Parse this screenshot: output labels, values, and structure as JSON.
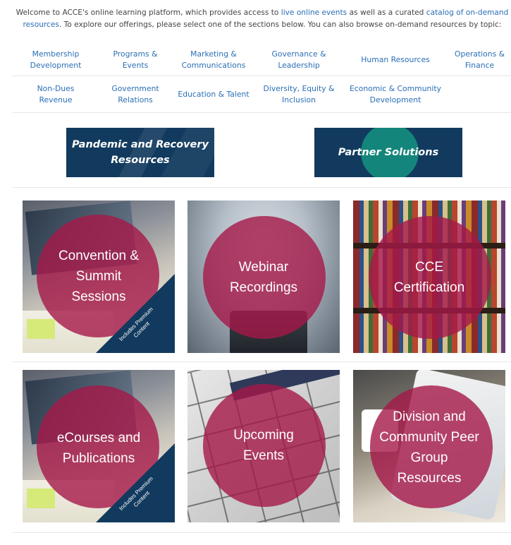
{
  "intro": {
    "text_1": "Welcome to ACCE's online learning platform, which provides access to ",
    "link_1": "live online events",
    "text_2": " as well as a curated ",
    "link_2": "catalog of on-demand resources",
    "text_3": ". To explore our offerings, please select one of the sections below. You can also browse on-demand resources by topic:"
  },
  "topics": {
    "row1": [
      {
        "line1": "Membership",
        "line2": "Development"
      },
      {
        "line1": "Programs &",
        "line2": "Events"
      },
      {
        "line1": "Marketing &",
        "line2": "Communications"
      },
      {
        "line1": "Governance &",
        "line2": "Leadership"
      },
      {
        "line1": "Human Resources",
        "line2": ""
      },
      {
        "line1": "Operations &",
        "line2": "Finance"
      }
    ],
    "row2": [
      {
        "line1": "Non-Dues",
        "line2": "Revenue"
      },
      {
        "line1": "Government",
        "line2": "Relations"
      },
      {
        "line1": "Education & Talent",
        "line2": ""
      },
      {
        "line1": "Diversity, Equity &",
        "line2": "Inclusion"
      },
      {
        "line1": "Economic & Community",
        "line2": "Development"
      }
    ]
  },
  "banners": {
    "pandemic": {
      "line1": "Pandemic and Recovery",
      "line2": "Resources"
    },
    "partner": {
      "line1": "Partner Solutions"
    }
  },
  "tiles": {
    "convention": {
      "lines": [
        "Convention &",
        "Summit",
        "Sessions"
      ],
      "badge": [
        "Includes Premium",
        "Content"
      ]
    },
    "webinar": {
      "lines": [
        "Webinar",
        "Recordings"
      ]
    },
    "cce": {
      "lines": [
        "CCE",
        "Certification"
      ]
    },
    "ecourses": {
      "lines": [
        "eCourses and",
        "Publications"
      ],
      "badge": [
        "Includes Premium",
        "Content"
      ]
    },
    "upcoming": {
      "lines": [
        "Upcoming",
        "Events"
      ]
    },
    "division": {
      "lines": [
        "Division and",
        "Community Peer",
        "Group",
        "Resources"
      ]
    }
  },
  "colors": {
    "link_blue": "#2a6fb5",
    "navy": "#123a5e",
    "teal": "#14857a",
    "magenta_overlay": "#a51848"
  }
}
